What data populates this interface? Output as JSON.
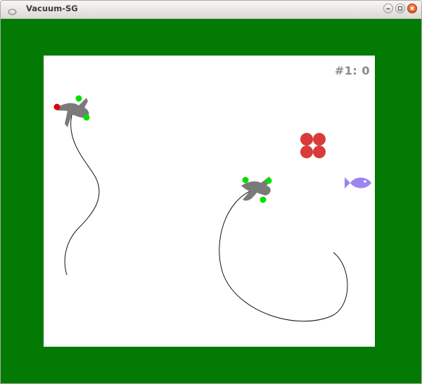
{
  "window": {
    "title": "Vacuum-SG",
    "menu_icon": "window-menu-icon",
    "buttons": [
      "minimize-icon",
      "maximize-icon",
      "close-icon"
    ]
  },
  "colors": {
    "border_field": "#037a03",
    "arena": "#ffffff",
    "ship": "#7a7a7a",
    "ship_dot_green": "#00e000",
    "ship_dot_red": "#e00000",
    "flower": "#d93a3a",
    "fish": "#9b86f0",
    "score_text": "#8a8a8a"
  },
  "game": {
    "score_label": "#1: 0",
    "players": [
      {
        "name": "player-1-ship",
        "red_dot": true
      },
      {
        "name": "player-2-ship",
        "red_dot": false
      }
    ],
    "items": [
      "flower-pickup",
      "fish-pickup"
    ]
  }
}
